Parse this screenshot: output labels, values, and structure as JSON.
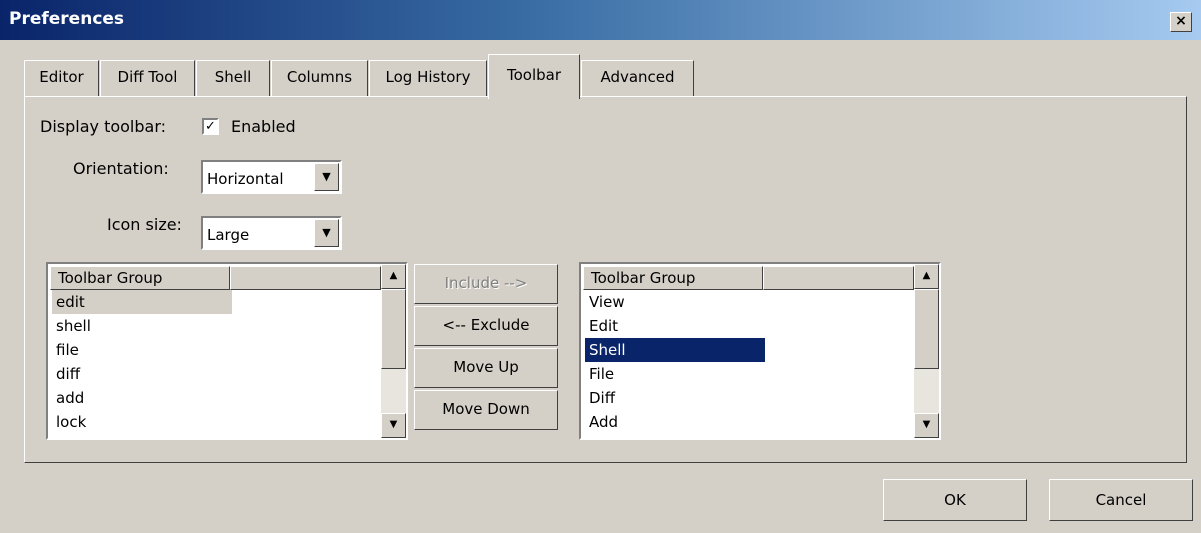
{
  "window": {
    "title": "Preferences",
    "close_glyph": "×"
  },
  "tabs": [
    {
      "label": "Editor"
    },
    {
      "label": "Diff Tool"
    },
    {
      "label": "Shell"
    },
    {
      "label": "Columns"
    },
    {
      "label": "Log History"
    },
    {
      "label": "Toolbar",
      "active": true
    },
    {
      "label": "Advanced"
    }
  ],
  "display_toolbar": {
    "label": "Display toolbar:",
    "checkbox_label": "Enabled",
    "checked": true,
    "check_glyph": "✓"
  },
  "orientation": {
    "label": "Orientation:",
    "value": "Horizontal"
  },
  "icon_size": {
    "label": "Icon size:",
    "value": "Large"
  },
  "left_list": {
    "header": "Toolbar Group",
    "items": [
      "edit",
      "shell",
      "file",
      "diff",
      "add",
      "lock"
    ],
    "selected_index": 0
  },
  "right_list": {
    "header": "Toolbar Group",
    "items": [
      "View",
      "Edit",
      "Shell",
      "File",
      "Diff",
      "Add"
    ],
    "selected_index": 2
  },
  "middle_buttons": {
    "include": "Include -->",
    "exclude": "<-- Exclude",
    "move_up": "Move Up",
    "move_down": "Move Down"
  },
  "footer": {
    "ok": "OK",
    "cancel": "Cancel"
  },
  "glyphs": {
    "arrow_up": "▲",
    "arrow_down": "▼"
  },
  "icons": [
    "close-icon",
    "check-icon",
    "dropdown-arrow-icon",
    "scroll-up-arrow-icon",
    "scroll-down-arrow-icon"
  ],
  "colors": {
    "face": "#d4d0c8",
    "title_start": "#0a246a",
    "title_end": "#a6caf0",
    "selection": "#0a246a"
  }
}
